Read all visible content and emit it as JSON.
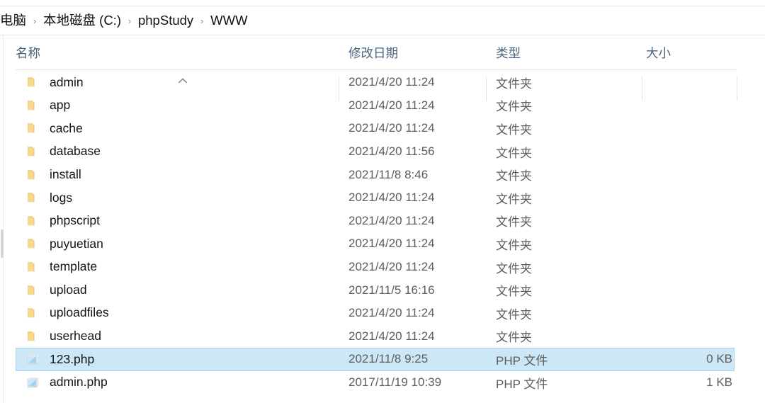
{
  "window": {
    "title": "WWW"
  },
  "address_bar": {
    "separator": "›",
    "crumbs": [
      {
        "label": "电脑"
      },
      {
        "label": "本地磁盘 (C:)"
      },
      {
        "label": "phpStudy"
      },
      {
        "label": "WWW"
      }
    ]
  },
  "columns": {
    "sort_indicator": "ascending",
    "sort_column": "name",
    "headers": [
      {
        "key": "name",
        "label": "名称"
      },
      {
        "key": "date",
        "label": "修改日期"
      },
      {
        "key": "type",
        "label": "类型"
      },
      {
        "key": "size",
        "label": "大小"
      }
    ]
  },
  "colors": {
    "selection": "#cce8f7",
    "selection_border": "#a6d6ef",
    "header_text": "#4a6480",
    "folder_icon": "#f7d98b",
    "php_icon": "#9fd5ef"
  },
  "files": [
    {
      "name": "admin",
      "date": "2021/4/20 11:24",
      "type": "文件夹",
      "size": "",
      "icon": "folder-icon",
      "selected": false
    },
    {
      "name": "app",
      "date": "2021/4/20 11:24",
      "type": "文件夹",
      "size": "",
      "icon": "folder-icon",
      "selected": false
    },
    {
      "name": "cache",
      "date": "2021/4/20 11:24",
      "type": "文件夹",
      "size": "",
      "icon": "folder-icon",
      "selected": false
    },
    {
      "name": "database",
      "date": "2021/4/20 11:56",
      "type": "文件夹",
      "size": "",
      "icon": "folder-icon",
      "selected": false
    },
    {
      "name": "install",
      "date": "2021/11/8 8:46",
      "type": "文件夹",
      "size": "",
      "icon": "folder-icon",
      "selected": false
    },
    {
      "name": "logs",
      "date": "2021/4/20 11:24",
      "type": "文件夹",
      "size": "",
      "icon": "folder-icon",
      "selected": false
    },
    {
      "name": "phpscript",
      "date": "2021/4/20 11:24",
      "type": "文件夹",
      "size": "",
      "icon": "folder-icon",
      "selected": false
    },
    {
      "name": "puyuetian",
      "date": "2021/4/20 11:24",
      "type": "文件夹",
      "size": "",
      "icon": "folder-icon",
      "selected": false
    },
    {
      "name": "template",
      "date": "2021/4/20 11:24",
      "type": "文件夹",
      "size": "",
      "icon": "folder-icon",
      "selected": false
    },
    {
      "name": "upload",
      "date": "2021/11/5 16:16",
      "type": "文件夹",
      "size": "",
      "icon": "folder-icon",
      "selected": false
    },
    {
      "name": "uploadfiles",
      "date": "2021/4/20 11:24",
      "type": "文件夹",
      "size": "",
      "icon": "folder-icon",
      "selected": false
    },
    {
      "name": "userhead",
      "date": "2021/4/20 11:24",
      "type": "文件夹",
      "size": "",
      "icon": "folder-icon",
      "selected": false
    },
    {
      "name": "123.php",
      "date": "2021/11/8 9:25",
      "type": "PHP 文件",
      "size": "0 KB",
      "icon": "php-file-icon",
      "selected": true
    },
    {
      "name": "admin.php",
      "date": "2017/11/19 10:39",
      "type": "PHP 文件",
      "size": "1 KB",
      "icon": "php-file-icon",
      "selected": false
    }
  ]
}
